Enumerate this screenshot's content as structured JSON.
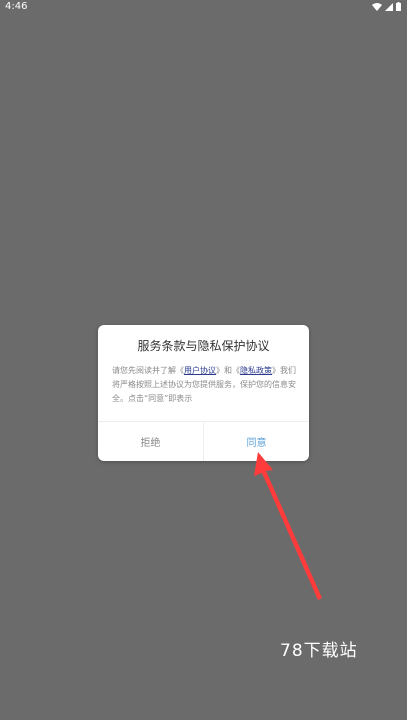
{
  "status_bar": {
    "time": "4:46",
    "icons": [
      "wifi-icon",
      "signal-icon",
      "battery-icon"
    ]
  },
  "dialog": {
    "title": "服务条款与隐私保护协议",
    "body": {
      "prefix": "请您先阅读并了解《",
      "link1": "用户协议",
      "mid1": "》和《",
      "link2": "隐私政策",
      "suffix": "》我们将严格按照上述协议为您提供服务，保护您的信息安全。点击“同意”即表示"
    },
    "buttons": {
      "reject": "拒绝",
      "agree": "同意"
    }
  },
  "watermark": "78下载站",
  "colors": {
    "overlay_background": "#6b6b6b",
    "dialog_background": "#ffffff",
    "link": "#2a3a8f",
    "agree_button": "#5a9ed6",
    "arrow": "#ff3b3b"
  }
}
